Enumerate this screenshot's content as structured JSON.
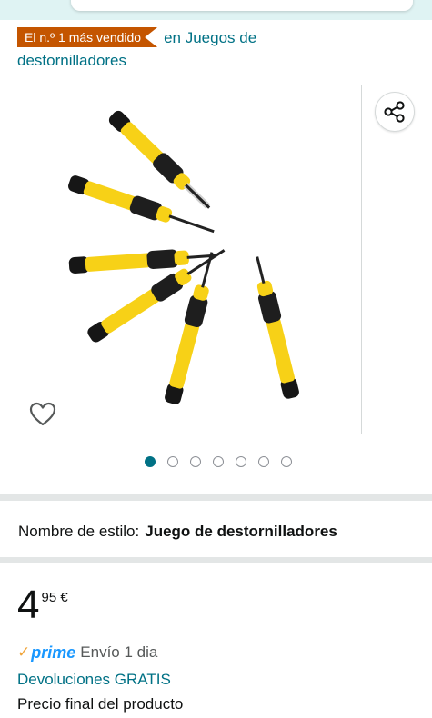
{
  "bestseller": {
    "badge": "El n.º 1 más vendido",
    "category_link": "en Juegos de destornilladores"
  },
  "gallery": {
    "image_alt": "Juego de destornilladores de precisión amarillo y negro",
    "image_count": 7,
    "active_index": 0,
    "share_icon": "share-icon",
    "favorite_icon": "heart-icon"
  },
  "style": {
    "label": "Nombre de estilo:",
    "value": "Juego de destornilladores"
  },
  "price": {
    "whole": "4",
    "fraction": "95",
    "currency": "€"
  },
  "delivery": {
    "prime_check": "✓",
    "prime_label": "prime",
    "text": "Envío 1 dia"
  },
  "returns_link": "Devoluciones GRATIS",
  "final_price_note": "Precio final del producto",
  "colors": {
    "badge": "#c45500",
    "link": "#007185",
    "prime": "#1a98ff",
    "tool_yellow": "#f7d117"
  }
}
